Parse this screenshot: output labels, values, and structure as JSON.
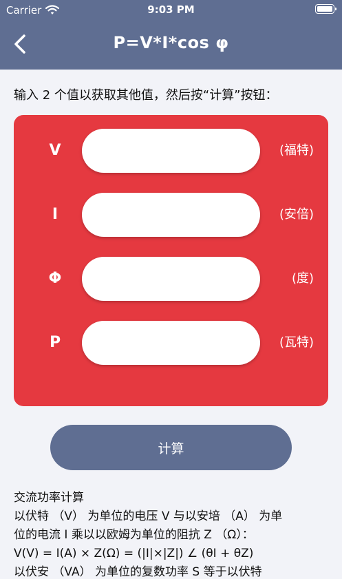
{
  "status_bar": {
    "carrier": "Carrier",
    "time": "9:03 PM",
    "wifi_icon": "wifi-icon",
    "battery_icon": "battery-icon"
  },
  "nav": {
    "back_icon": "chevron-left-icon",
    "title": "P=V*I*cos φ"
  },
  "instruction": "输入 2 个值以获取其他值，然后按“计算”按钮：",
  "fields": [
    {
      "label": "V",
      "value": "",
      "unit": "(福特)"
    },
    {
      "label": "I",
      "value": "",
      "unit": "(安倍)"
    },
    {
      "label": "Φ",
      "value": "",
      "unit": "(度)"
    },
    {
      "label": "P",
      "value": "",
      "unit": "(瓦特)"
    }
  ],
  "calculate_label": "计算",
  "description": [
    "交流功率计算",
    "以伏特 （V） 为单位的电压 V 与以安培 （A） 为单",
    "位的电流 I 乘以以欧姆为单位的阻抗 Z （Ω）：",
    "V(V) = I(A) × Z(Ω) = (|I|×|Z|) ∠ (θI + θZ)",
    "以伏安 （VA） 为单位的复数功率 S 等于以伏特"
  ],
  "colors": {
    "header": "#5f6e92",
    "card": "#e53940",
    "button": "#5f6e92",
    "background": "#f2f3f8"
  }
}
